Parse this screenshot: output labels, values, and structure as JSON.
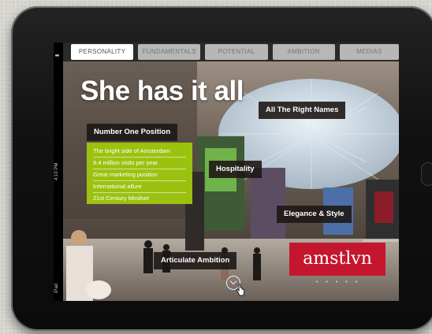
{
  "status_bar": {
    "carrier": "iPad",
    "time": "4:10 PM"
  },
  "tabs": [
    {
      "label": "PERSONALITY",
      "active": true
    },
    {
      "label": "FUNDAMENTALS",
      "active": false
    },
    {
      "label": "POTENTIAL",
      "active": false
    },
    {
      "label": "AMBITION",
      "active": false
    },
    {
      "label": "MEDIAS",
      "active": false
    }
  ],
  "headline": "She has it all",
  "labels": {
    "all_the_right_names": "All The Right Names",
    "number_one_position": "Number One Position",
    "hospitality": "Hospitality",
    "elegance_style": "Elegance & Style",
    "articulate_ambition": "Articulate Ambition"
  },
  "number_one_list": [
    "The bright side of Amsterdam",
    "9.4 million visits per year",
    "Great marketing position",
    "International allure",
    "21st Century Mindset"
  ],
  "brand": {
    "name": "amstlvn",
    "color": "#c4162f"
  },
  "pagination": "• • • • •",
  "colors": {
    "accent_green": "#a0c80e",
    "tab_inactive": "#b7b7b7",
    "label_bg": "#1e1816"
  }
}
